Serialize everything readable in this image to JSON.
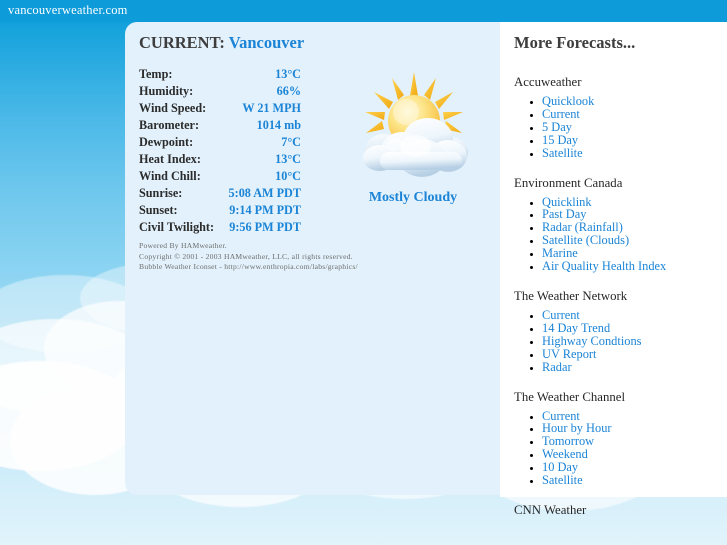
{
  "site": {
    "name": "vancouverweather.com",
    "accent_blue": "#1b84d6",
    "bar_blue": "#0d9bd9",
    "panel_blue": "#e2f1fb"
  },
  "current": {
    "heading_label": "CURRENT:",
    "city": "Vancouver",
    "condition": "Mostly Cloudy",
    "icon": "sun-behind-cloud-icon",
    "observations": [
      {
        "label": "Temp:",
        "value": "13°C"
      },
      {
        "label": "Humidity:",
        "value": "66%"
      },
      {
        "label": "Wind Speed:",
        "value": "W 21 MPH"
      },
      {
        "label": "Barometer:",
        "value": "1014 mb"
      },
      {
        "label": "Dewpoint:",
        "value": "7°C"
      },
      {
        "label": "Heat Index:",
        "value": "13°C"
      },
      {
        "label": "Wind Chill:",
        "value": "10°C"
      },
      {
        "label": "Sunrise:",
        "value": "5:08 AM PDT"
      },
      {
        "label": "Sunset:",
        "value": "9:14 PM PDT"
      },
      {
        "label": "Civil Twilight:",
        "value": "9:56 PM PDT"
      }
    ]
  },
  "credits": {
    "line1": "Powered By HAMweather.",
    "line2": "Copyright © 2001 - 2003 HAMweather, LLC, all rights reserved.",
    "line3": "Bubble Weather Iconset - http://www.enthropia.com/labs/graphics/"
  },
  "forecasts": {
    "heading": "More Forecasts...",
    "providers": [
      {
        "name": "Accuweather",
        "links": [
          "Quicklook",
          "Current",
          "5 Day",
          "15 Day",
          "Satellite"
        ]
      },
      {
        "name": "Environment Canada",
        "links": [
          "Quicklink",
          "Past Day",
          "Radar (Rainfall)",
          "Satellite (Clouds)",
          "Marine",
          "Air Quality Health Index"
        ]
      },
      {
        "name": "The Weather Network",
        "links": [
          "Current",
          "14 Day Trend",
          "Highway Condtions",
          "UV Report",
          "Radar"
        ]
      },
      {
        "name": "The Weather Channel",
        "links": [
          "Current",
          "Hour by Hour",
          "Tomorrow",
          "Weekend",
          "10 Day",
          "Satellite"
        ]
      },
      {
        "name": "CNN Weather",
        "links": []
      }
    ]
  }
}
